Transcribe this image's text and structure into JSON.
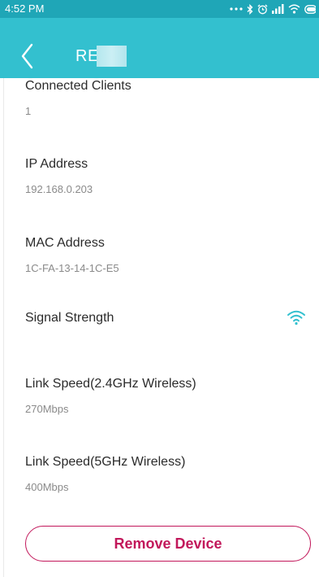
{
  "status_bar": {
    "time": "4:52 PM"
  },
  "app_bar": {
    "title": "RE"
  },
  "details": {
    "connected_clients": {
      "label": "Connected Clients",
      "value": "1"
    },
    "ip_address": {
      "label": "IP Address",
      "value": "192.168.0.203"
    },
    "mac_address": {
      "label": "MAC Address",
      "value": "1C-FA-13-14-1C-E5"
    },
    "signal_strength": {
      "label": "Signal Strength",
      "icon": "wifi-signal-icon"
    },
    "link_speed_24": {
      "label": "Link Speed(2.4GHz Wireless)",
      "value": "270Mbps"
    },
    "link_speed_5": {
      "label": "Link Speed(5GHz Wireless)",
      "value": "400Mbps"
    }
  },
  "actions": {
    "remove_label": "Remove Device"
  },
  "colors": {
    "status_bar": "#1fa6b7",
    "app_bar": "#33c0cf",
    "accent": "#c2185b",
    "wifi": "#33c0cf"
  }
}
